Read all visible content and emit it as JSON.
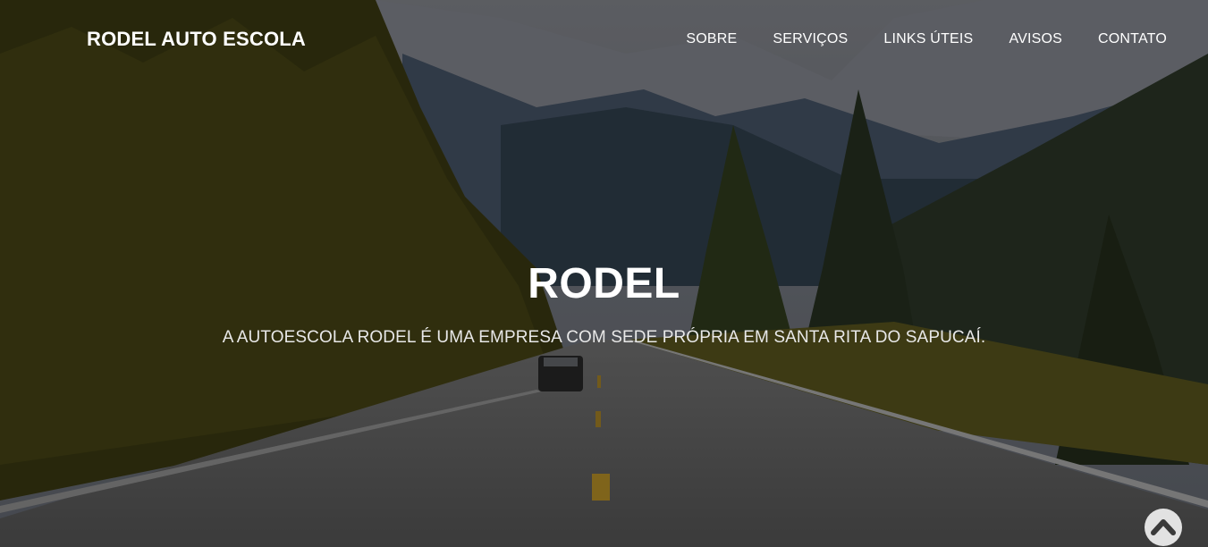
{
  "navbar": {
    "brand": "RODEL AUTO ESCOLA",
    "links": [
      {
        "label": "SOBRE"
      },
      {
        "label": "SERVIÇOS"
      },
      {
        "label": "LINKS ÚTEIS"
      },
      {
        "label": "AVISOS"
      },
      {
        "label": "CONTATO"
      }
    ]
  },
  "hero": {
    "title": "RODEL",
    "subtitle": "A AUTOESCOLA RODEL É UMA EMPRESA COM SEDE PRÓPRIA EM SANTA RITA DO SAPUCAÍ."
  },
  "scroll_top": {
    "icon": "chevron-up-icon"
  },
  "colors": {
    "sky": "#7d8088",
    "mountain": "#3d4a5a",
    "forest": "#3b3a12",
    "road": "#565656",
    "road_line": "#c9a227"
  }
}
